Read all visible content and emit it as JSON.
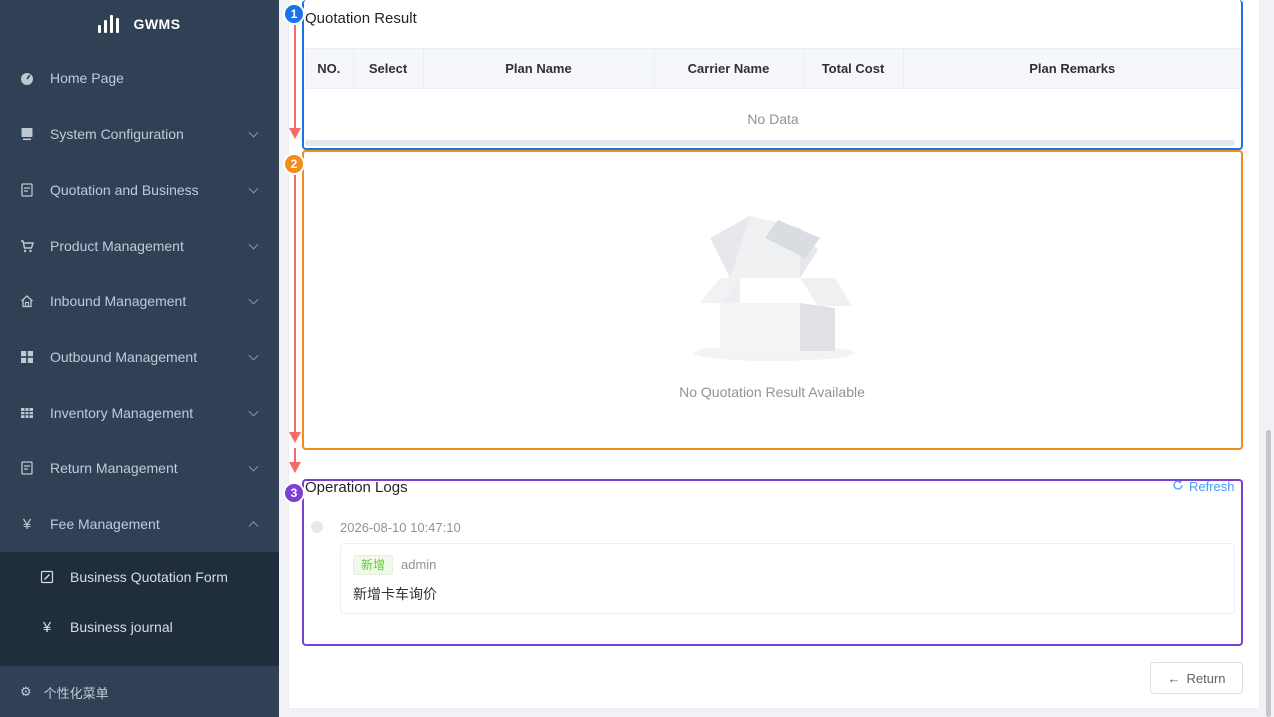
{
  "app": {
    "logo_text": "GWMS"
  },
  "sidebar": {
    "items": [
      {
        "label": "Home Page",
        "icon": "dashboard-icon"
      },
      {
        "label": "System Configuration",
        "icon": "monitor-icon"
      },
      {
        "label": "Quotation and Business",
        "icon": "document-icon"
      },
      {
        "label": "Product Management",
        "icon": "cart-icon"
      },
      {
        "label": "Inbound Management",
        "icon": "home-icon"
      },
      {
        "label": "Outbound Management",
        "icon": "grid-icon"
      },
      {
        "label": "Inventory Management",
        "icon": "table-icon"
      },
      {
        "label": "Return Management",
        "icon": "document-icon"
      },
      {
        "label": "Fee Management",
        "icon": "yen-icon"
      }
    ],
    "sub_items": [
      {
        "label": "Business Quotation Form",
        "icon": "edit-icon"
      },
      {
        "label": "Business journal",
        "icon": "yen-icon"
      }
    ],
    "personal": "个性化菜单"
  },
  "quotation": {
    "title": "Quotation Result",
    "columns": [
      "NO.",
      "Select",
      "Plan Name",
      "Carrier Name",
      "Total Cost",
      "Plan Remarks"
    ],
    "no_data": "No Data",
    "empty_text": "No Quotation Result Available"
  },
  "logs": {
    "title": "Operation Logs",
    "refresh_label": "Refresh",
    "entries": [
      {
        "time": "2026-08-10 10:47:10",
        "tag": "新增",
        "user": "admin",
        "content": "新增卡车询价"
      }
    ]
  },
  "return_label": "Return",
  "annotations": [
    {
      "number": "1",
      "color": "#1a73e8"
    },
    {
      "number": "2",
      "color": "#f28c1b"
    },
    {
      "number": "3",
      "color": "#7b3fd4"
    }
  ]
}
